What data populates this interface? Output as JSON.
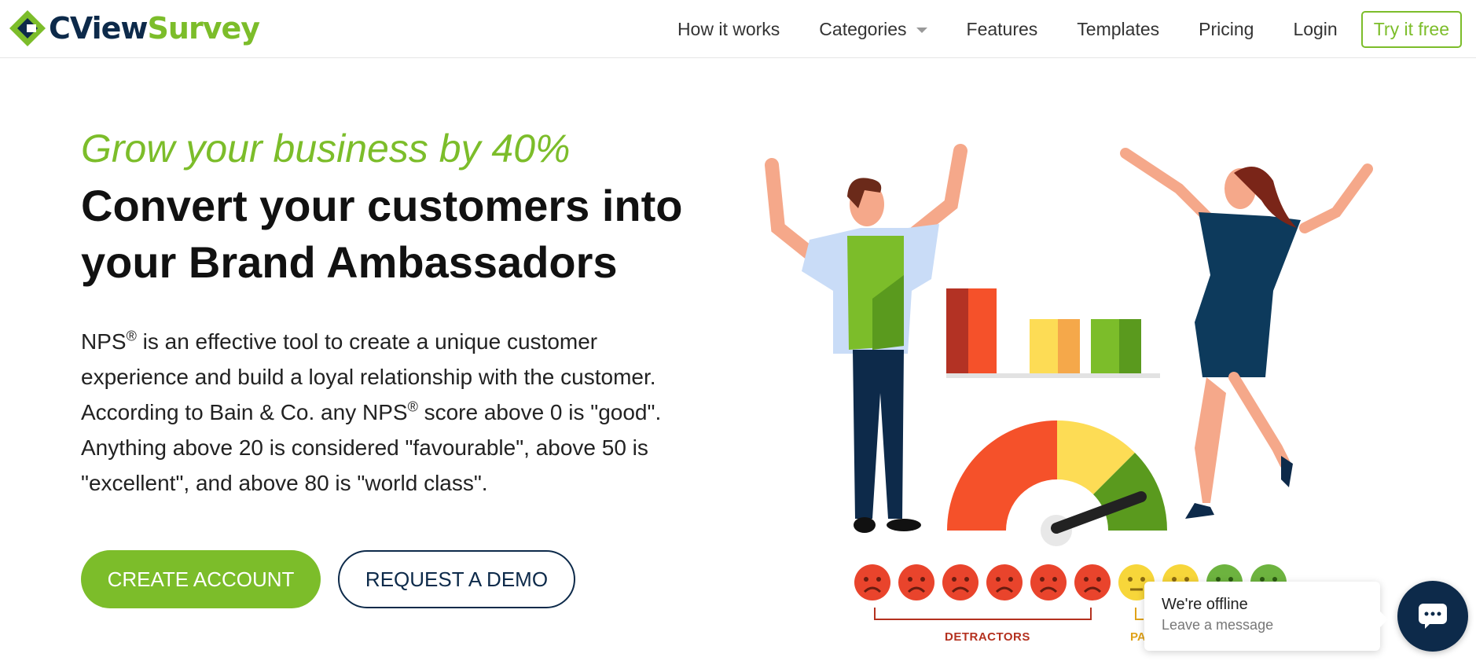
{
  "brand": {
    "name_part1": "CView",
    "name_part2": "Survey",
    "primary_color": "#7cbd2a",
    "dark_color": "#0d2a4a"
  },
  "nav": {
    "how_it_works": "How it works",
    "categories": "Categories",
    "features": "Features",
    "templates": "Templates",
    "pricing": "Pricing",
    "login": "Login",
    "try_free": "Try it free"
  },
  "hero": {
    "tagline": "Grow your business by 40%",
    "headline_line1": "Convert your customers into",
    "headline_line2": "your Brand Ambassadors",
    "desc_nps1": "NPS",
    "reg_mark": "®",
    "desc_part1": " is an effective tool to create a unique customer experience and build a loyal relationship with the customer. According to Bain & Co. any ",
    "desc_nps2": "NPS",
    "desc_part2": " score above 0 is \"good\". Anything above 20 is considered \"favourable\", above 50 is \"excellent\", and above 80 is \"world class\".",
    "create_account": "CREATE ACCOUNT",
    "request_demo": "REQUEST A DEMO"
  },
  "illustration": {
    "detractors": "DETRACTORS",
    "passives_partial": "PA"
  },
  "chat": {
    "title": "We're offline",
    "subtitle": "Leave a message",
    "icon": "chat-icon"
  }
}
